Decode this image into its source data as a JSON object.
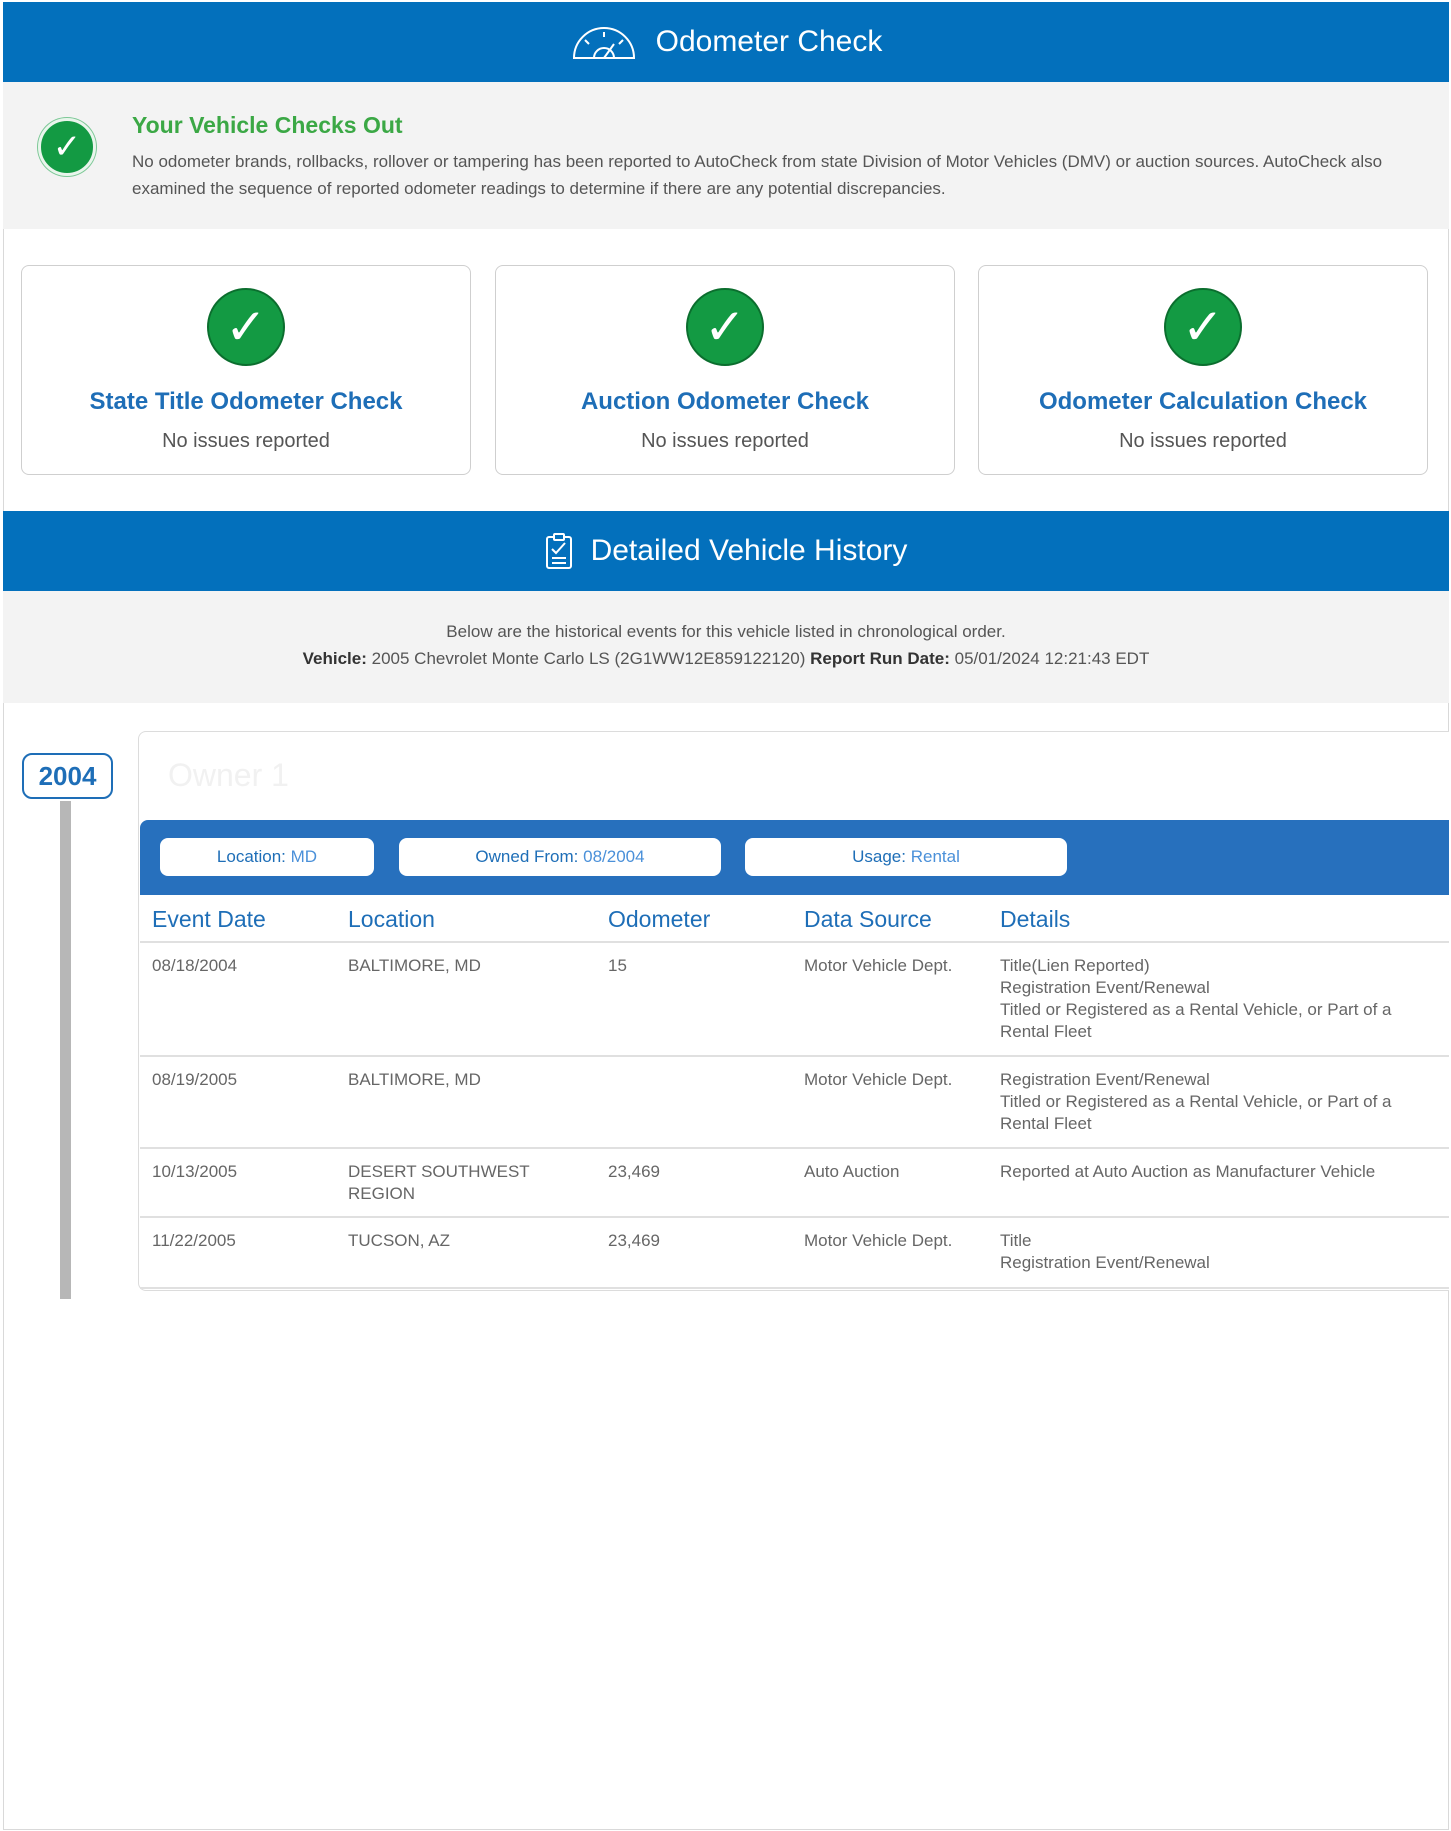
{
  "odometer_banner": {
    "title": "Odometer Check",
    "icon": "speedometer-icon"
  },
  "status": {
    "title": "Your Vehicle Checks Out",
    "text": "No odometer brands, rollbacks, rollover or tampering has been reported to AutoCheck from state Division of Motor Vehicles (DMV) or auction sources. AutoCheck also examined the sequence of reported odometer readings to determine if there are any potential discrepancies.",
    "icon": "check-circle-icon",
    "color": "#3ba845"
  },
  "cards": [
    {
      "title": "State Title Odometer Check",
      "subtitle": "No issues reported"
    },
    {
      "title": "Auction Odometer Check",
      "subtitle": "No issues reported"
    },
    {
      "title": "Odometer Calculation Check",
      "subtitle": "No issues reported"
    }
  ],
  "history_banner": {
    "title": "Detailed Vehicle History",
    "icon": "clipboard-check-icon"
  },
  "history": {
    "intro": "Below are the historical events for this vehicle listed in chronological order.",
    "vehicle_label": "Vehicle:",
    "vehicle_value": "2005 Chevrolet Monte Carlo LS (2G1WW12E859122120)",
    "report_label": "Report Run Date:",
    "report_value": "05/01/2024 12:21:43 EDT"
  },
  "timeline": {
    "year": "2004"
  },
  "owner": {
    "title": "Owner 1",
    "location_label": "Location:",
    "location_value": "MD",
    "owned_label": "Owned From:",
    "owned_value": "08/2004",
    "usage_label": "Usage:",
    "usage_value": "Rental"
  },
  "table": {
    "headers": [
      "Event Date",
      "Location",
      "Odometer",
      "Data Source",
      "Details"
    ],
    "rows": [
      {
        "date": "08/18/2004",
        "location": "BALTIMORE, MD",
        "odometer": "15",
        "source": "Motor Vehicle Dept.",
        "details": [
          "Title(Lien Reported)",
          "Registration Event/Renewal",
          "Titled or Registered as a Rental Vehicle, or Part of a Rental Fleet"
        ]
      },
      {
        "date": "08/19/2005",
        "location": "BALTIMORE, MD",
        "odometer": "",
        "source": "Motor Vehicle Dept.",
        "details": [
          "Registration Event/Renewal",
          "Titled or Registered as a Rental Vehicle, or Part of a Rental Fleet"
        ]
      },
      {
        "date": "10/13/2005",
        "location": "DESERT SOUTHWEST REGION",
        "odometer": "23,469",
        "source": "Auto Auction",
        "details": [
          "Reported at Auto Auction as Manufacturer Vehicle"
        ]
      },
      {
        "date": "11/22/2005",
        "location": "TUCSON, AZ",
        "odometer": "23,469",
        "source": "Motor Vehicle Dept.",
        "details": [
          "Title",
          "Registration Event/Renewal"
        ]
      }
    ]
  },
  "colors": {
    "brand_blue": "#0370bc",
    "check_green": "#139a43",
    "link_blue": "#1e6eb7"
  }
}
